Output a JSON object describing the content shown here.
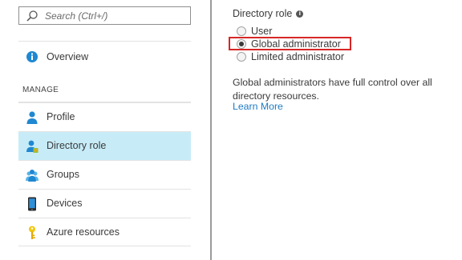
{
  "search": {
    "placeholder": "Search (Ctrl+/)"
  },
  "nav": {
    "overview_label": "Overview",
    "section_manage": "MANAGE",
    "items": [
      {
        "label": "Profile",
        "icon": "user-icon"
      },
      {
        "label": "Directory role",
        "icon": "directory-role-icon",
        "selected": true
      },
      {
        "label": "Groups",
        "icon": "groups-icon"
      },
      {
        "label": "Devices",
        "icon": "device-icon"
      },
      {
        "label": "Azure resources",
        "icon": "key-icon"
      }
    ]
  },
  "directory_role": {
    "title": "Directory role",
    "options": [
      {
        "label": "User",
        "checked": false
      },
      {
        "label": "Global administrator",
        "checked": true
      },
      {
        "label": "Limited administrator",
        "checked": false
      }
    ],
    "description": "Global administrators have full control over all directory resources.",
    "learn_more": "Learn More"
  },
  "colors": {
    "selected_bg": "#c7ecf8",
    "link": "#1e7bc4",
    "highlight_border": "#d72626",
    "icon_blue": "#1f88d1"
  }
}
